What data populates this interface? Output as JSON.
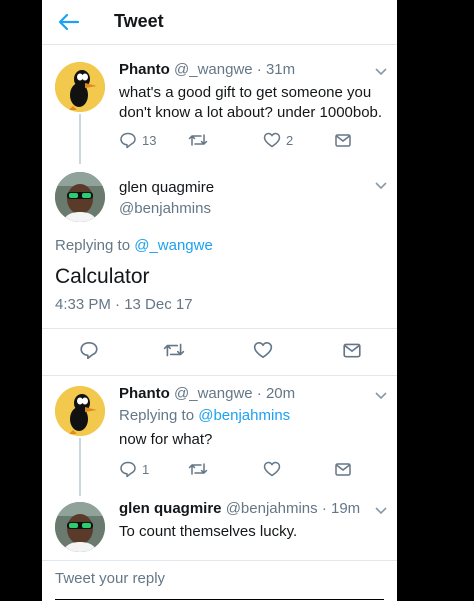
{
  "header": {
    "title": "Tweet"
  },
  "tweets": [
    {
      "name": "Phanto",
      "handle": "@_wangwe",
      "time": "31m",
      "text": "what's a good gift to get someone you don't know a lot about? under 1000bob.",
      "replies": "13",
      "likes": "2"
    },
    {
      "name": "glen quagmire",
      "handle": "@benjahmins",
      "replying_prefix": "Replying to ",
      "replying_to": "@_wangwe",
      "text": "Calculator",
      "timestamp": "4:33 PM · 13 Dec 17"
    },
    {
      "name": "Phanto",
      "handle": "@_wangwe",
      "time": "20m",
      "replying_prefix": "Replying to ",
      "replying_to": "@benjahmins",
      "text": "now for what?",
      "replies": "1"
    },
    {
      "name": "glen quagmire",
      "handle": "@benjahmins",
      "time": "19m",
      "text": "To count themselves lucky."
    }
  ],
  "reply_input": {
    "placeholder": "Tweet your reply"
  },
  "colors": {
    "accent": "#1da1f2",
    "muted": "#657786",
    "border": "#e1e8ed"
  }
}
